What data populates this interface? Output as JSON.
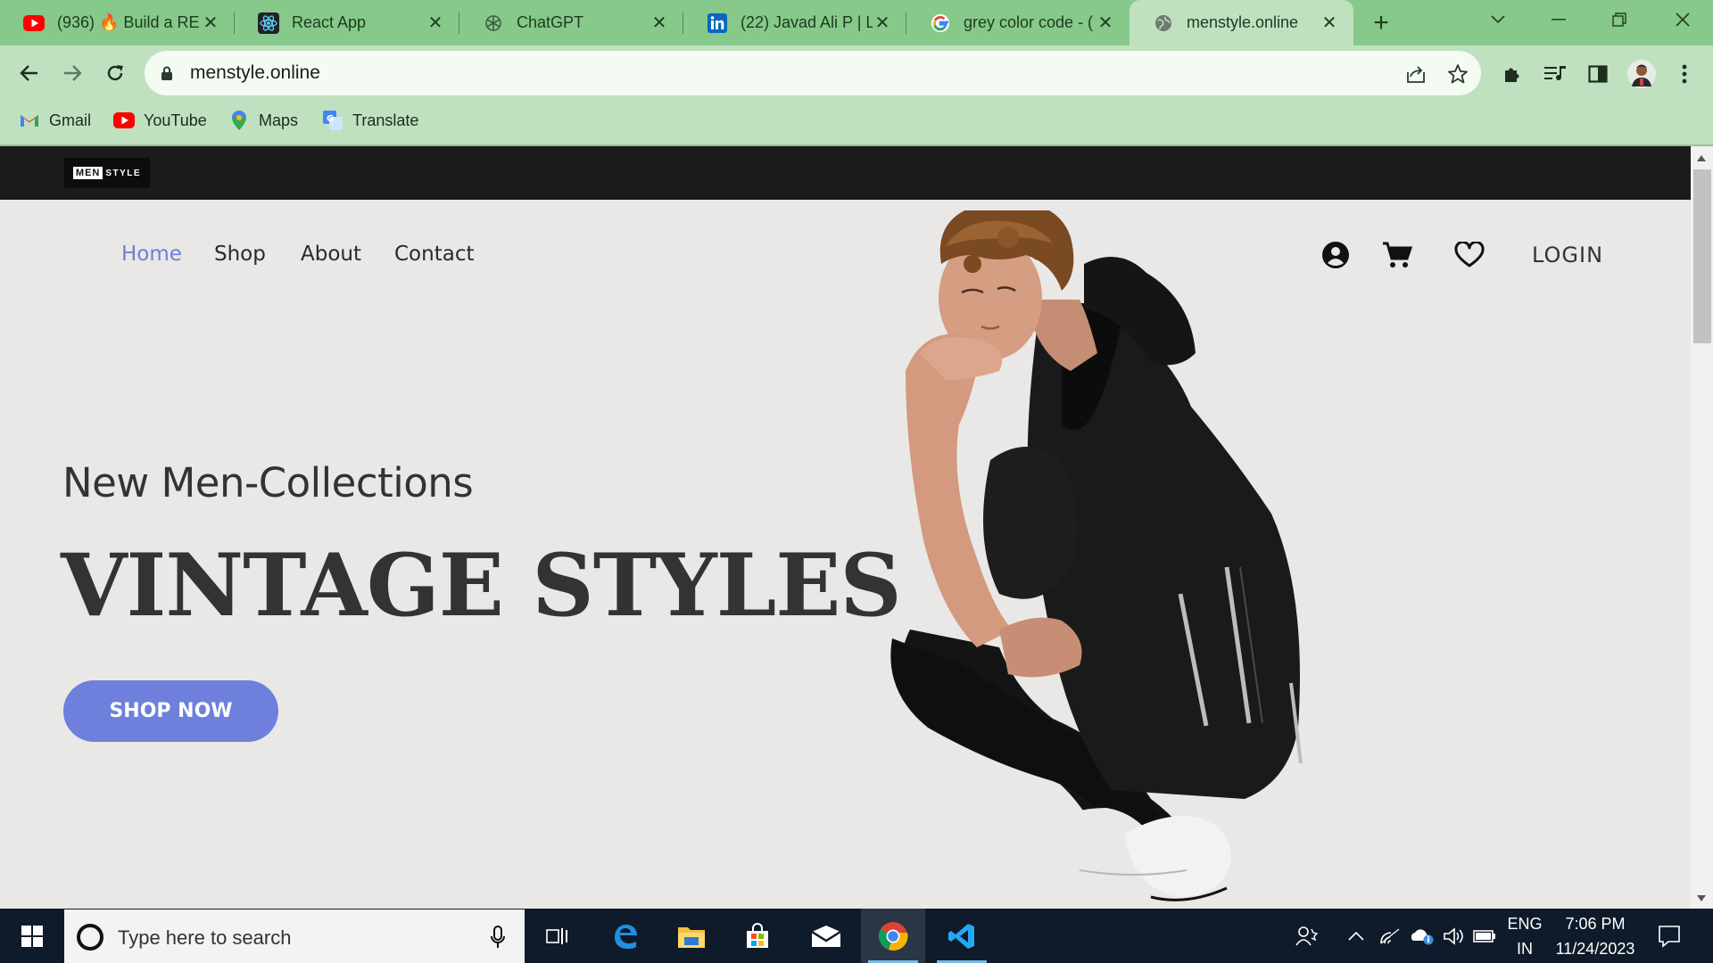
{
  "browser": {
    "tabs": [
      {
        "title": "(936) 🔥 Build a RE",
        "icon": "youtube-icon"
      },
      {
        "title": "React App",
        "icon": "react-icon"
      },
      {
        "title": "ChatGPT",
        "icon": "chatgpt-icon"
      },
      {
        "title": "(22) Javad Ali P | Li",
        "icon": "linkedin-icon"
      },
      {
        "title": "grey color code - (",
        "icon": "google-icon"
      },
      {
        "title": "menstyle.online",
        "icon": "globe-icon",
        "active": true
      }
    ],
    "url": "menstyle.online",
    "bookmarks": [
      {
        "label": "Gmail",
        "icon": "gmail-icon"
      },
      {
        "label": "YouTube",
        "icon": "youtube-icon"
      },
      {
        "label": "Maps",
        "icon": "maps-icon"
      },
      {
        "label": "Translate",
        "icon": "translate-icon"
      }
    ]
  },
  "site": {
    "logo_men": "MEN",
    "logo_style": "STYLE",
    "nav": [
      "Home",
      "Shop",
      "About",
      "Contact"
    ],
    "active_nav": "Home",
    "login": "LOGIN",
    "subtitle": "New Men-Collections",
    "headline": "VINTAGE STYLES",
    "cta": "SHOP NOW",
    "accent_color": "#6e7fdc",
    "header_icons": [
      "account-icon",
      "cart-icon",
      "heart-icon"
    ]
  },
  "taskbar": {
    "search_placeholder": "Type here to search",
    "language_top": "ENG",
    "language_bottom": "IN",
    "time": "7:06 PM",
    "date": "11/24/2023"
  }
}
